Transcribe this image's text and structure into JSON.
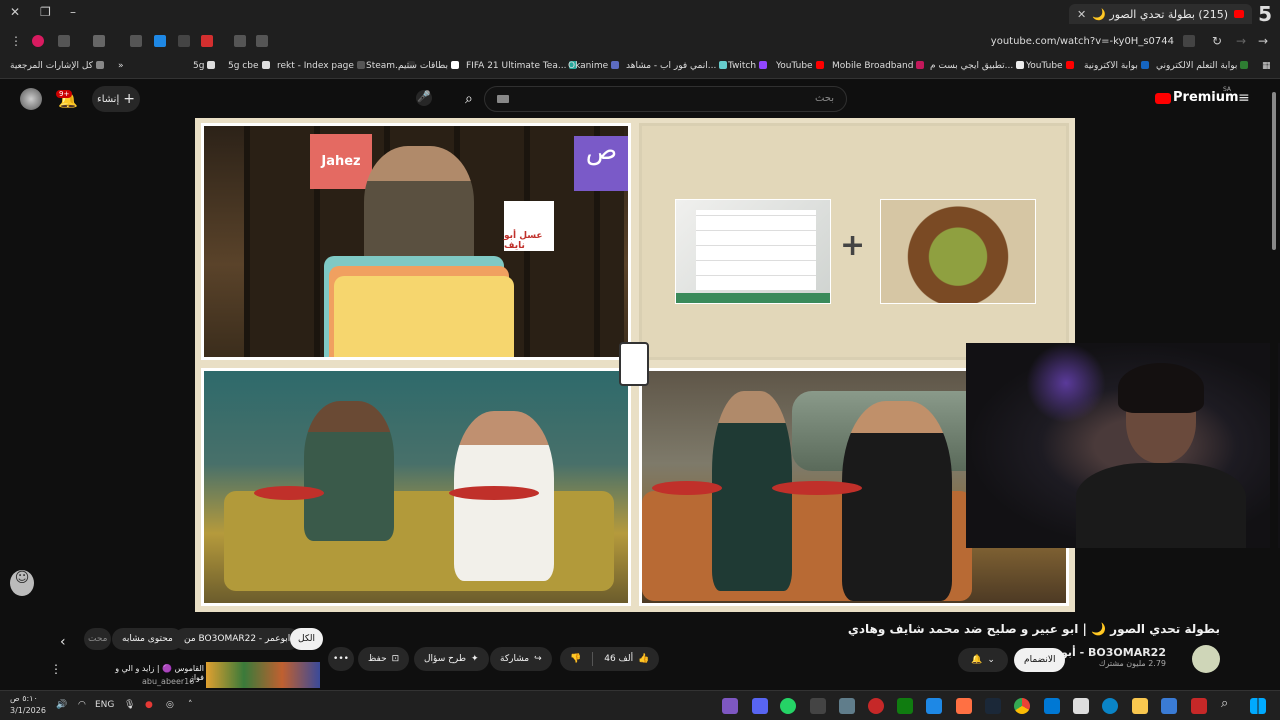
{
  "browser": {
    "tab_title": "(215) بطولة تحدي الصور 🌙",
    "tab_count": "5",
    "url": "youtube.com/watch?v=-ky0H_s0744"
  },
  "bookmarks": [
    {
      "label": "بوابة التعلم الالكتروني",
      "color": "#2e7d32"
    },
    {
      "label": "بوابة الاكترونية",
      "color": "#1565c0"
    },
    {
      "label": "YouTube",
      "color": "#f00"
    },
    {
      "label": "تطبيق ايجي بست م...",
      "color": "#eee"
    },
    {
      "label": "Mobile Broadband",
      "color": "#c2185b"
    },
    {
      "label": "YouTube",
      "color": "#f00"
    },
    {
      "label": "Twitch",
      "color": "#9146ff"
    },
    {
      "label": "انمي فور اب - مشاهد...",
      "color": "#6cc"
    },
    {
      "label": "Okanime",
      "color": "#5c6bc0"
    },
    {
      "label": "FIFA 21 Ultimate Tea...",
      "color": "#26a69a"
    },
    {
      "label": "بطاقات ستيم",
      "color": "#fff"
    },
    {
      "label": "Steam...",
      "color": "#333"
    },
    {
      "label": "rekt - Index page",
      "color": "#555"
    },
    {
      "label": "5g cbe",
      "color": "#ddd"
    },
    {
      "label": "5g",
      "color": "#ddd"
    }
  ],
  "bookmarks_all": "كل الإشارات المرجعية",
  "youtube": {
    "premium": "Premium",
    "region": "SA",
    "search_placeholder": "بحث",
    "create_label": "إنشاء",
    "notif_count": "9+"
  },
  "video": {
    "jahez_label": "Jahez",
    "sign_label": "عسل أبو نايف",
    "title": "بطولة تحدي الصور 🌙 | ابو عبير و صليح ضد محمد شايف وهادي",
    "channel_name": "BO3OMAR22 - أبوعمر",
    "channel_subs": "2.79 مليون مشترك",
    "join_label": "الانضمام",
    "likes": "46 ألف",
    "share_label": "مشاركة",
    "ask_label": "طرح سؤال",
    "save_label": "حفظ"
  },
  "chips": {
    "all": "الكل",
    "from": "من BO3OMAR22 - ابوعمر",
    "related": "محتوى مشابه",
    "more": "محت"
  },
  "next_video": {
    "title": "القاموس 🟣 | زايد و الي و فواز",
    "channel": "abu_abeer16"
  },
  "taskbar": {
    "time": "٥:١٠ ص",
    "date": "3/1/2026",
    "lang": "ENG"
  }
}
